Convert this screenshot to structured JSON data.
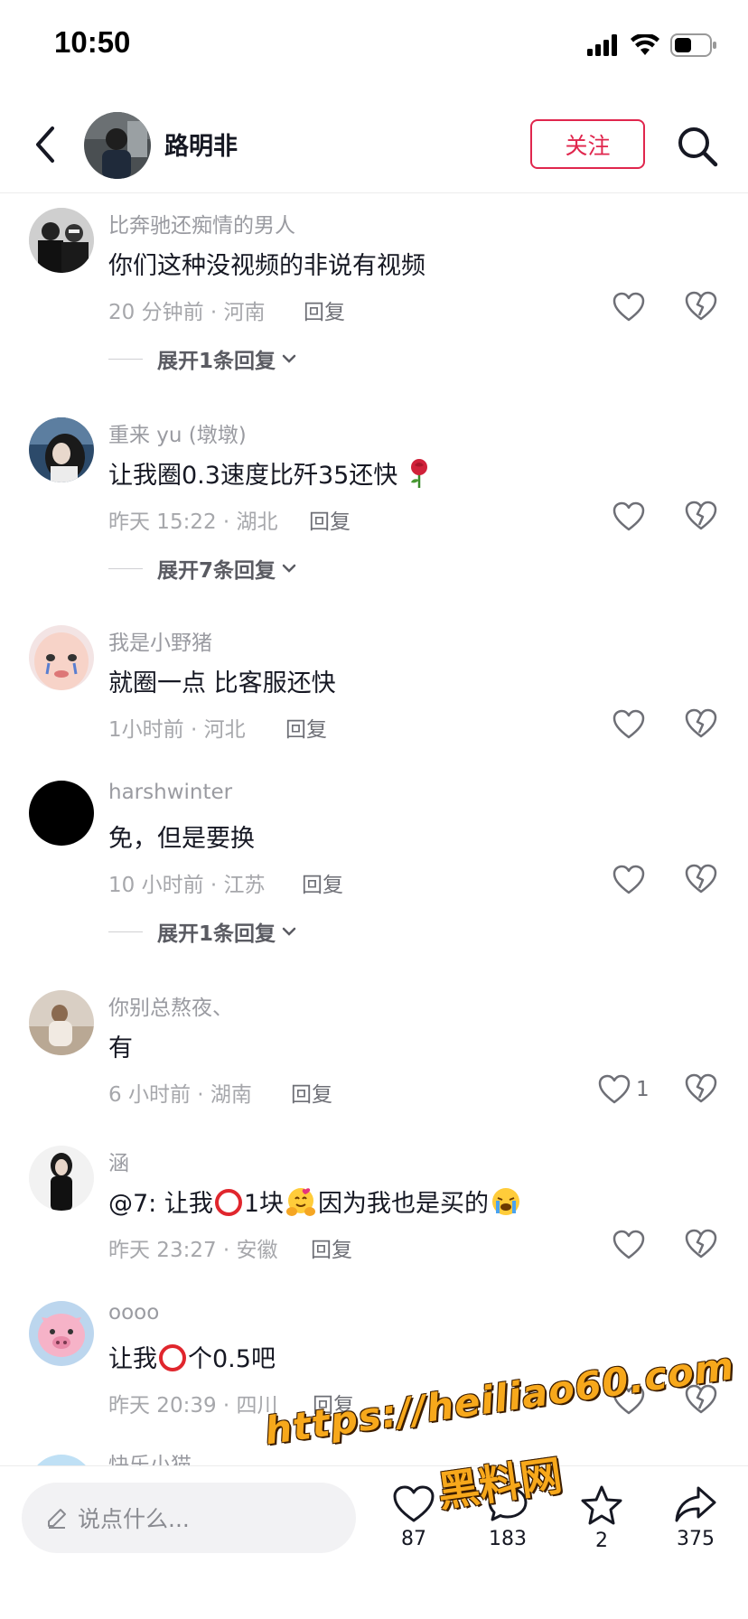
{
  "status_bar": {
    "time": "10:50"
  },
  "header": {
    "name": "路明非",
    "follow_label": "关注"
  },
  "comments": [
    {
      "user": "比奔驰还痴情的男人",
      "text": "你们这种没视频的非说有视频",
      "meta": "20 分钟前 · 河南",
      "reply": "回复",
      "likes": "",
      "expand": "展开1条回复"
    },
    {
      "user": "重来 yu (墩墩)",
      "text": "让我圈0.3速度比歼35还快",
      "meta": "昨天 15:22 · 湖北",
      "reply": "回复",
      "likes": "",
      "expand": "展开7条回复"
    },
    {
      "user": "我是小野猪",
      "text": "就圈一点 比客服还快",
      "meta": "1小时前 · 河北",
      "reply": "回复",
      "likes": "",
      "expand": ""
    },
    {
      "user": "harshwinter",
      "text": "免，但是要换",
      "meta": "10 小时前 · 江苏",
      "reply": "回复",
      "likes": "",
      "expand": "展开1条回复"
    },
    {
      "user": "你别总熬夜、",
      "text": "有",
      "meta": "6 小时前 · 湖南",
      "reply": "回复",
      "likes": "1",
      "expand": ""
    },
    {
      "user": "涵",
      "text_a": "@7: 让我",
      "text_b": "1块",
      "text_c": "因为我也是买的",
      "meta": "昨天 23:27 · 安徽",
      "reply": "回复",
      "likes": "",
      "expand": ""
    },
    {
      "user": "oooo",
      "text_a": "让我",
      "text_b": "个0.5吧",
      "meta": "昨天 20:39 · 四川",
      "reply": "回复",
      "likes": "",
      "expand": ""
    },
    {
      "user": "快乐小猫"
    }
  ],
  "bottom_bar": {
    "input_placeholder": "说点什么...",
    "like_count": "87",
    "comment_count": "183",
    "favorite_count": "2",
    "share_count": "375"
  },
  "watermark": {
    "url": "https://heiliao60.com",
    "name": "黑料网"
  },
  "colors": {
    "accent": "#e0264d",
    "watermark": "#f7a81b"
  },
  "icons": [
    "back-icon",
    "search-icon",
    "heart-icon",
    "broken-heart-icon",
    "chevron-down-icon",
    "pencil-icon",
    "comment-icon",
    "star-icon",
    "share-icon",
    "rose-emoji",
    "red-circle-emoji",
    "hug-emoji",
    "crying-emoji"
  ]
}
